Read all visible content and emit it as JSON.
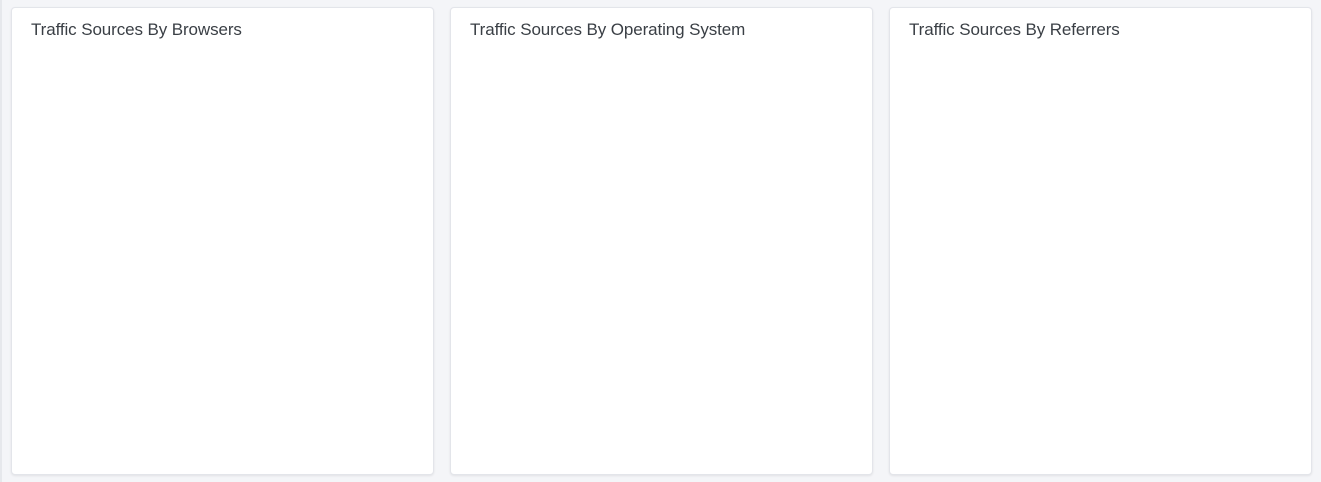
{
  "cards": [
    {
      "title": "Traffic Sources By Browsers"
    },
    {
      "title": "Traffic Sources By Operating System"
    },
    {
      "title": "Traffic Sources By Referrers"
    }
  ]
}
